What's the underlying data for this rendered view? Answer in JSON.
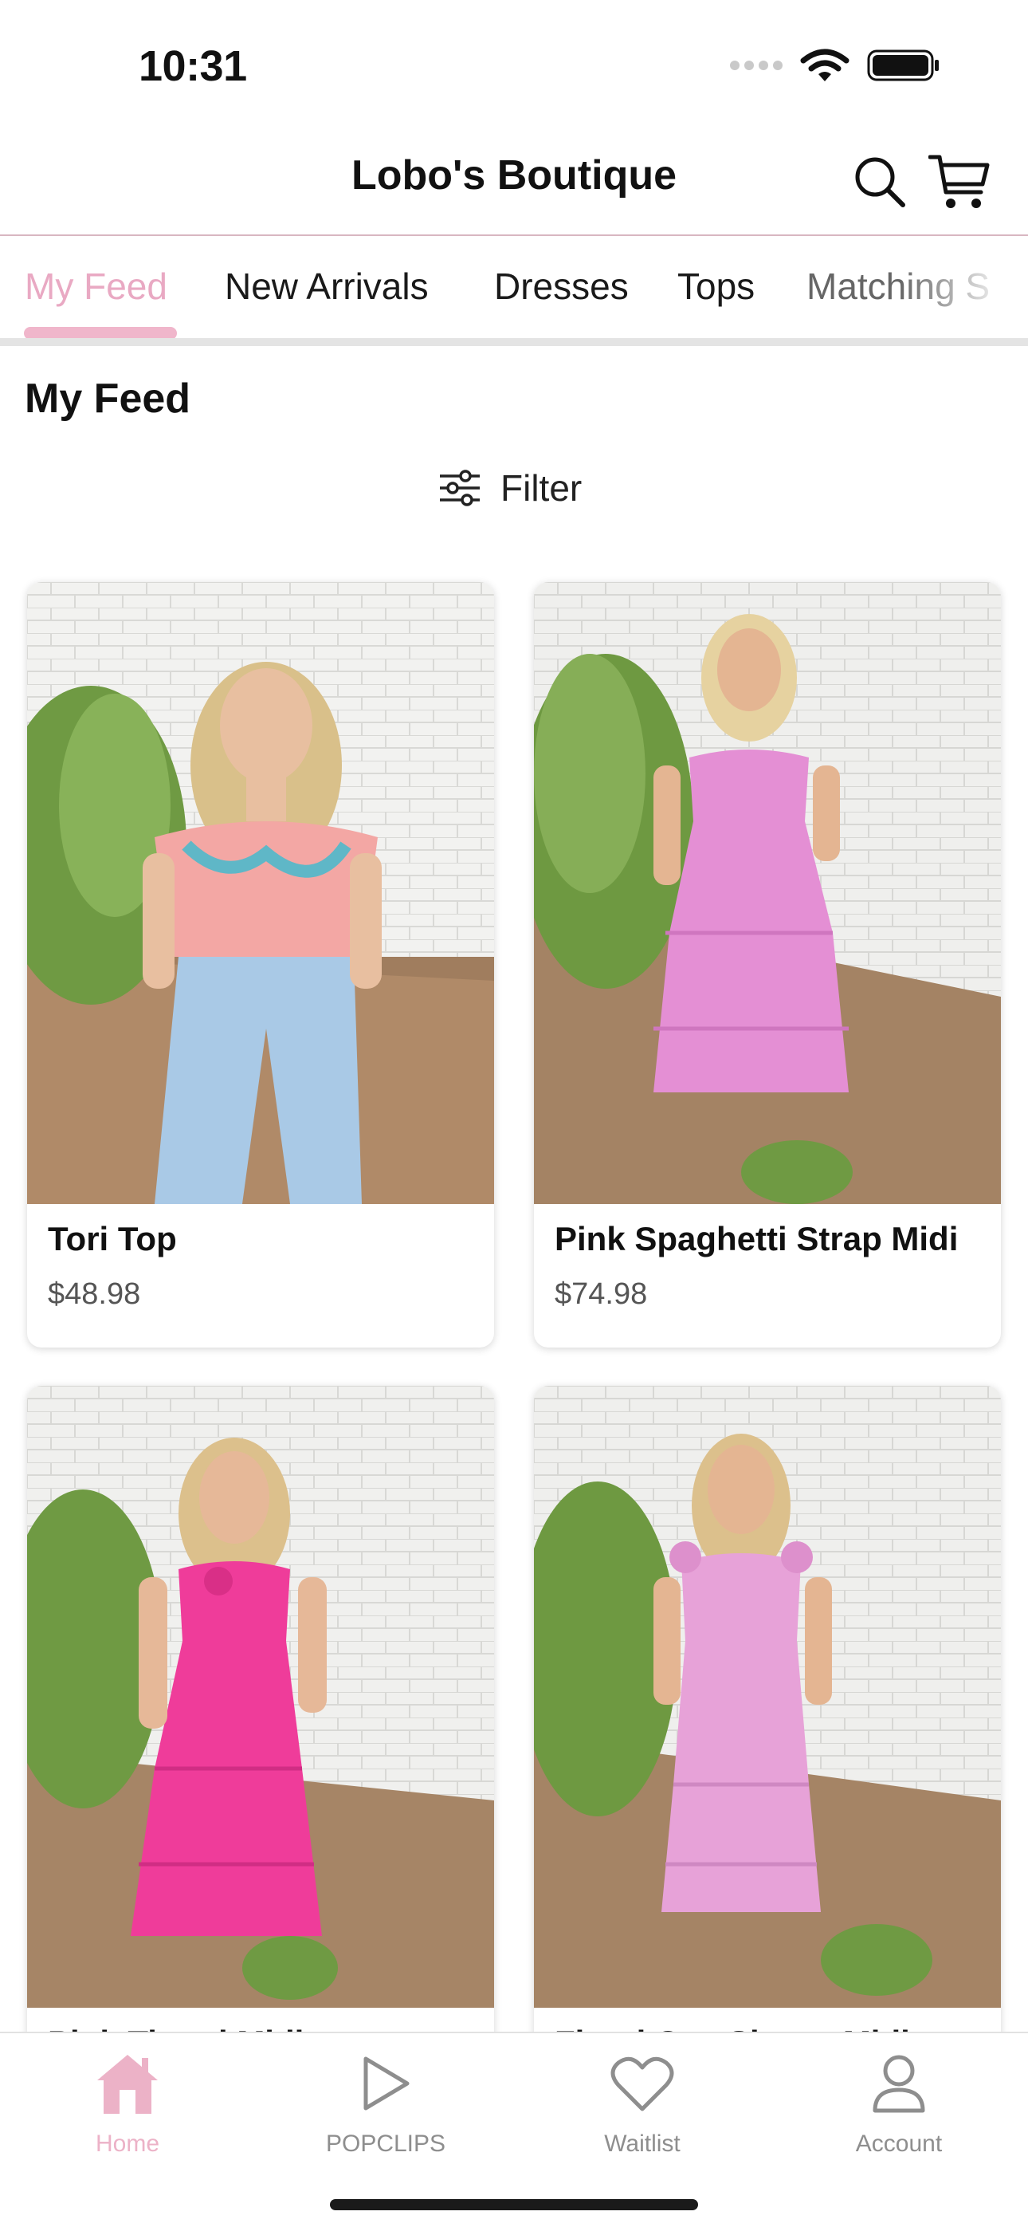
{
  "status_bar": {
    "time": "10:31"
  },
  "header": {
    "title": "Lobo's Boutique"
  },
  "categories": [
    {
      "label": "My Feed"
    },
    {
      "label": "New Arrivals"
    },
    {
      "label": "Dresses"
    },
    {
      "label": "Tops"
    },
    {
      "label": "Matching S"
    }
  ],
  "feed": {
    "title": "My Feed",
    "filter_label": "Filter"
  },
  "products": [
    {
      "name": "Tori Top",
      "price": "$48.98",
      "top_color": "#f3a7a4",
      "bottom_color": "#a9c9e6"
    },
    {
      "name": "Pink Spaghetti Strap Midi",
      "price": "$74.98",
      "dress_color": "#e48fd4"
    },
    {
      "name": "Pink Tiered Midi",
      "price": "",
      "dress_color": "#ef3c9a"
    },
    {
      "name": "Floral Cap Sleeve Midi",
      "price": "",
      "dress_color": "#e7a2d8"
    }
  ],
  "tabbar": [
    {
      "label": "Home",
      "icon": "home-icon",
      "active": true
    },
    {
      "label": "POPCLIPS",
      "icon": "play-icon"
    },
    {
      "label": "Waitlist",
      "icon": "heart-icon"
    },
    {
      "label": "Account",
      "icon": "person-icon"
    }
  ],
  "colors": {
    "accent": "#ecb2c7",
    "tab_indicator": "#f0b6cb"
  }
}
